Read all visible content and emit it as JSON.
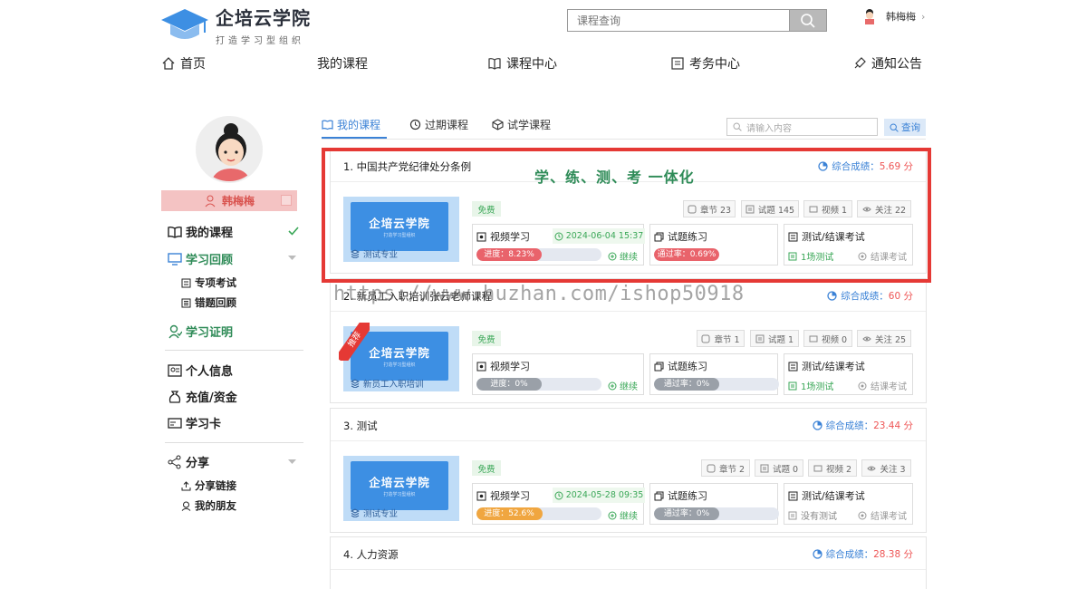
{
  "header": {
    "logo_title": "企培云学院",
    "logo_subtitle": "打造学习型组织",
    "search_placeholder": "课程查询",
    "user_name": "韩梅梅"
  },
  "nav": [
    {
      "label": "首页",
      "icon": "home-icon"
    },
    {
      "label": "我的课程",
      "icon": ""
    },
    {
      "label": "课程中心",
      "icon": "book-icon"
    },
    {
      "label": "考务中心",
      "icon": "exam-icon"
    },
    {
      "label": "通知公告",
      "icon": "notice-icon"
    }
  ],
  "sidebar": {
    "name": "韩梅梅",
    "items": [
      {
        "label": "我的课程"
      },
      {
        "label": "学习回顾"
      },
      {
        "label": "专项考试"
      },
      {
        "label": "错题回顾"
      },
      {
        "label": "学习证明"
      },
      {
        "label": "个人信息"
      },
      {
        "label": "充值/资金"
      },
      {
        "label": "学习卡"
      },
      {
        "label": "分享"
      },
      {
        "label": "分享链接"
      },
      {
        "label": "我的朋友"
      }
    ]
  },
  "tabs": [
    {
      "label": "我的课程"
    },
    {
      "label": "过期课程"
    },
    {
      "label": "试学课程"
    }
  ],
  "content_search": {
    "placeholder": "请输入内容",
    "button": "查询"
  },
  "slogan": "学、练、测、考 一体化",
  "watermark": "https://www.huzhan.com/ishop50918",
  "labels": {
    "free": "免费",
    "video_study": "视频学习",
    "exercise": "试题练习",
    "test_exam": "测试/结课考试",
    "continue": "继续",
    "end_exam": "结课考试",
    "score_prefix": "综合成绩：",
    "thumb_title": "企培云学院",
    "thumb_sub": "打造学习型组织",
    "recommend": "推荐"
  },
  "courses": [
    {
      "title": "1. 中国共产党纪律处分条例",
      "score": "5.69 分",
      "category": "测试专业",
      "chapters": "章节 23",
      "questions": "试题 145",
      "videos": "视频 1",
      "follows": "关注 22",
      "date": "2024-06-04 15:37",
      "progress_text": "进度：8.23%",
      "progress": 8.23,
      "pass_text": "通过率：0.69%",
      "pass": 0.69,
      "tests": "1场测试"
    },
    {
      "title": "2. 新员工入职培训张云老师课程",
      "score": "60 分",
      "category": "新员工入职培训",
      "chapters": "章节 1",
      "questions": "试题 1",
      "videos": "视频 0",
      "follows": "关注 25",
      "date": "",
      "progress_text": "进度：0%",
      "progress": 0,
      "pass_text": "通过率：0%",
      "pass": 0,
      "tests": "1场测试"
    },
    {
      "title": "3. 测试",
      "score": "23.44 分",
      "category": "测试专业",
      "chapters": "章节 2",
      "questions": "试题 0",
      "videos": "视频 2",
      "follows": "关注 3",
      "date": "2024-05-28 09:35",
      "progress_text": "进度：52.6%",
      "progress": 52.6,
      "pass_text": "通过率：0%",
      "pass": 0,
      "tests": "没有测试"
    },
    {
      "title": "4. 人力资源",
      "score": "28.38 分"
    }
  ],
  "colors": {
    "accent": "#3b82d6",
    "green": "#2e8b57",
    "highlight": "#e53935",
    "progress_red": "#e9636b",
    "progress_orange": "#f0a640",
    "progress_gray": "#9aa0a8"
  }
}
